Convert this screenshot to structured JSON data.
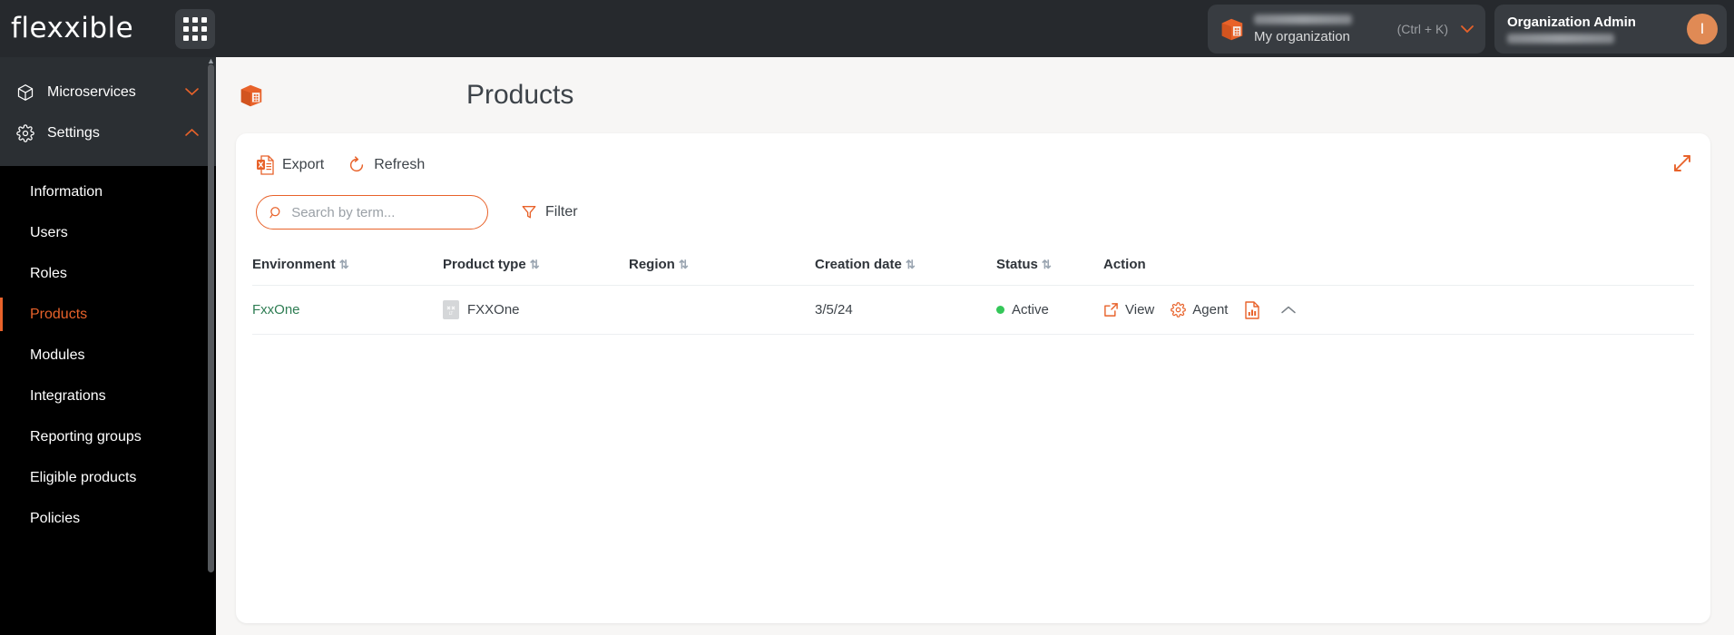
{
  "brand": {
    "logo_text": "flexxible",
    "accent": "#e8622a"
  },
  "topbar": {
    "apps_grid": "apps-grid",
    "org_switcher": {
      "org_name_redacted": "",
      "label": "My organization",
      "shortcut": "(Ctrl + K)"
    },
    "account": {
      "role": "Organization Admin",
      "email_redacted": "",
      "avatar_initial": "I"
    }
  },
  "sidebar": {
    "main_items": [
      {
        "label": "Microservices",
        "icon": "cube-icon",
        "chevron": "⌄",
        "expanded": false
      },
      {
        "label": "Settings",
        "icon": "gear-icon",
        "chevron": "⌃",
        "expanded": true
      }
    ],
    "sub_items": [
      {
        "label": "Information",
        "active": false
      },
      {
        "label": "Users",
        "active": false
      },
      {
        "label": "Roles",
        "active": false
      },
      {
        "label": "Products",
        "active": true
      },
      {
        "label": "Modules",
        "active": false
      },
      {
        "label": "Integrations",
        "active": false
      },
      {
        "label": "Reporting groups",
        "active": false
      },
      {
        "label": "Eligible products",
        "active": false
      },
      {
        "label": "Policies",
        "active": false
      }
    ]
  },
  "page": {
    "title": "Products",
    "icon": "package-box-icon"
  },
  "toolbar": {
    "export_label": "Export",
    "export_icon": "excel-file-icon",
    "refresh_label": "Refresh",
    "refresh_icon": "refresh-circle-icon",
    "expand_icon": "expand-diagonal-icon"
  },
  "search": {
    "placeholder": "Search by term...",
    "value": "",
    "icon": "search-icon"
  },
  "filter": {
    "label": "Filter",
    "icon": "funnel-icon"
  },
  "table": {
    "sort_glyph": "⇅",
    "columns": [
      {
        "key": "environment",
        "label": "Environment",
        "sortable": true
      },
      {
        "key": "product_type",
        "label": "Product type",
        "sortable": true
      },
      {
        "key": "region",
        "label": "Region",
        "sortable": true
      },
      {
        "key": "creation_date",
        "label": "Creation date",
        "sortable": true
      },
      {
        "key": "status",
        "label": "Status",
        "sortable": true
      },
      {
        "key": "action",
        "label": "Action",
        "sortable": false
      }
    ],
    "rows": [
      {
        "environment": "FxxOne",
        "product_type": "FXXOne",
        "product_type_logo": "fxxone-logo-icon",
        "region": "",
        "creation_date": "3/5/24",
        "status": "Active",
        "status_color": "#34c759",
        "actions": [
          {
            "label": "View",
            "icon": "external-link-icon"
          },
          {
            "label": "Agent",
            "icon": "gear-icon"
          },
          {
            "label": "",
            "icon": "report-document-icon"
          }
        ],
        "row_chevron": "⌃"
      }
    ]
  }
}
